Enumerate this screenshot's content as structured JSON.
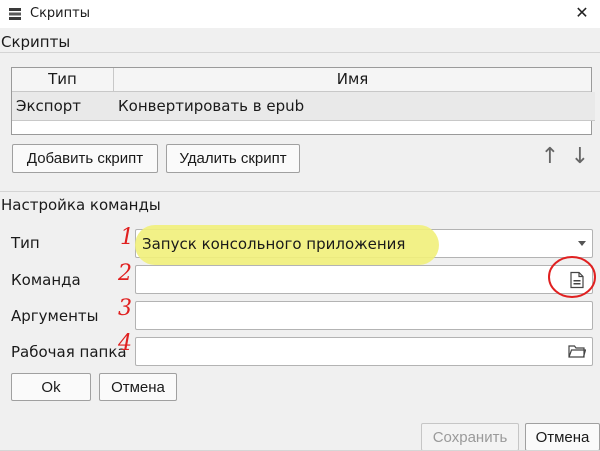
{
  "window": {
    "title": "Скрипты",
    "icon": "stack-layers-icon",
    "close_glyph": "✕"
  },
  "scripts": {
    "section_title": "Скрипты",
    "columns": [
      "Тип",
      "Имя"
    ],
    "rows": [
      {
        "type": "Экспорт",
        "name": "Конвертировать в epub"
      }
    ],
    "add_button": "Добавить скрипт",
    "remove_button": "Удалить скрипт",
    "move_up_glyph": "↑",
    "move_down_glyph": "↓"
  },
  "command": {
    "section_title": "Настройка команды",
    "type_label": "Тип",
    "type_value": "Запуск консольного приложения",
    "command_label": "Команда",
    "command_value": "",
    "arguments_label": "Аргументы",
    "arguments_value": "",
    "workdir_label": "Рабочая папка",
    "workdir_value": "",
    "ok_button": "Ok",
    "cancel_button": "Отмена"
  },
  "annotations": {
    "numbers": [
      "1",
      "2",
      "3",
      "4"
    ],
    "highlight_color": "#f1f07a",
    "circle_color": "#e02020"
  },
  "footer": {
    "save_button": "Сохранить",
    "cancel_button": "Отмена"
  }
}
